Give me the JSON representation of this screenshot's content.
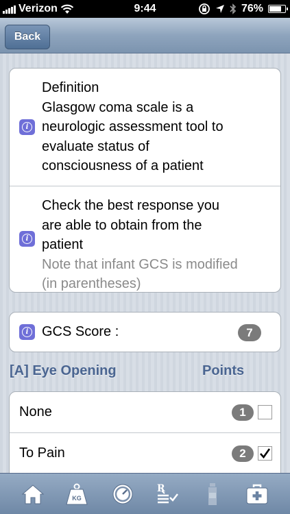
{
  "status_bar": {
    "carrier": "Verizon",
    "time": "9:44",
    "battery": "76%",
    "battery_level": 0.76
  },
  "nav": {
    "back_label": "Back"
  },
  "intro": {
    "definition_lines": [
      "Definition",
      "Glasgow coma scale is a",
      "neurologic assessment tool to",
      "evaluate status of",
      "consciousness of a patient"
    ],
    "instruction_lines": [
      "Check the best response you",
      "are able to obtain from the",
      "patient"
    ],
    "note_lines": [
      "Note that infant GCS is modified",
      "(in parentheses)"
    ]
  },
  "score": {
    "label": "GCS Score :",
    "value": "7"
  },
  "eye_opening": {
    "header": "[A] Eye Opening",
    "points_header": "Points",
    "options": [
      {
        "label": "None",
        "points": "1",
        "checked": false
      },
      {
        "label": "To Pain",
        "points": "2",
        "checked": true
      }
    ]
  },
  "tabs": [
    {
      "icon": "home-icon"
    },
    {
      "icon": "weight-kg-icon",
      "label": "KG"
    },
    {
      "icon": "timer-icon"
    },
    {
      "icon": "prescription-icon"
    },
    {
      "icon": "bottle-icon"
    },
    {
      "icon": "medical-kit-icon"
    }
  ],
  "colors": {
    "accent": "#4a6591",
    "info_icon": "#6f6fd8",
    "badge": "#7b7b7b"
  }
}
